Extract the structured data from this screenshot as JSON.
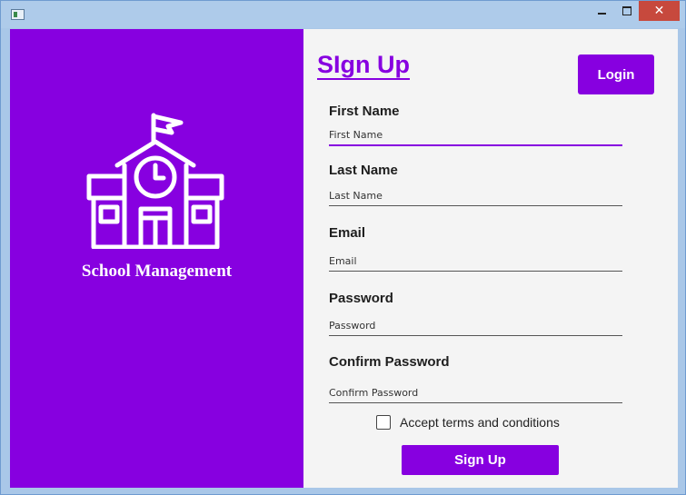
{
  "window": {
    "app_icon": "window-app-icon",
    "controls": {
      "minimize_icon": "minimize-icon",
      "maximize_icon": "maximize-icon",
      "close_icon": "close-icon",
      "close_glyph": "✕"
    }
  },
  "branding": {
    "logo_icon": "school-building-icon",
    "app_name": "School Management",
    "panel_color": "#8700e0"
  },
  "form": {
    "title": "SIgn Up",
    "login_label": "Login",
    "fields": [
      {
        "label": "First Name",
        "placeholder": "First Name"
      },
      {
        "label": "Last Name",
        "placeholder": "Last Name"
      },
      {
        "label": "Email",
        "placeholder": "Email"
      },
      {
        "label": "Password",
        "placeholder": "Password"
      },
      {
        "label": "Confirm Password",
        "placeholder": "Confirm Password"
      }
    ],
    "terms_label": "Accept terms and conditions",
    "terms_checked": false,
    "submit_label": "Sign Up",
    "accent_color": "#8700e0"
  }
}
